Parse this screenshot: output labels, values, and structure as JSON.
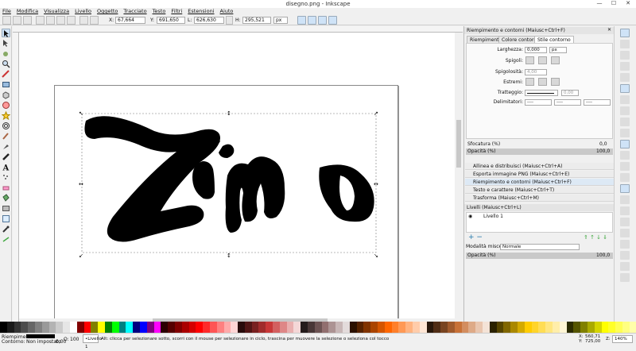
{
  "window": {
    "title": "disegno.png - Inkscape",
    "controls": [
      "—",
      "☐",
      "✕"
    ]
  },
  "menu": [
    "File",
    "Modifica",
    "Visualizza",
    "Livello",
    "Oggetto",
    "Tracciato",
    "Testo",
    "Filtri",
    "Estensioni",
    "Aiuto"
  ],
  "toolctrl": {
    "x_label": "X:",
    "x": "67,664",
    "y_label": "Y:",
    "y": "691,650",
    "w_label": "L:",
    "w": "626,630",
    "h_label": "H:",
    "h": "295,521",
    "unit": "px"
  },
  "dock": {
    "title": "Riempimento e contorni (Maiusc+Ctrl+F)",
    "tabs": [
      "Riempimento",
      "Colore contorno",
      "Stile contorno"
    ],
    "width_label": "Larghezza:",
    "width_value": "0,000",
    "width_unit": "px",
    "join_label": "Spigoli:",
    "miter_label": "Spigolosità:",
    "miter_value": "4,00",
    "cap_label": "Estremi:",
    "dash_label": "Tratteggio:",
    "dash_value": "0,00",
    "markers_label": "Delimitatori:",
    "marker_value": "----",
    "blur_label": "Sfocatura (%)",
    "blur_value": "0,0",
    "opacity_label": "Opacità (%)",
    "opacity_value": "100,0",
    "panels": [
      "Allinea e distribuisci (Maiusc+Ctrl+A)",
      "Esporta immagine PNG (Maiusc+Ctrl+E)",
      "Riempimento e contorni (Maiusc+Ctrl+F)",
      "Testo e carattere (Maiusc+Ctrl+T)",
      "Trasforma (Maiusc+Ctrl+M)"
    ],
    "layers_title": "Livelli (Maiusc+Ctrl+L)",
    "layer_name": "Livello 1",
    "blend_label": "Modalità miscela:",
    "blend_value": "Normale",
    "layer_opacity_label": "Opacità (%)",
    "layer_opacity_value": "100,0"
  },
  "status": {
    "fill_label": "Riempimento:",
    "stroke_label": "Contorno:",
    "stroke_value": "Non impostato",
    "stroke_width": "0,00",
    "opacity_label": "O:",
    "opacity_value": "100",
    "layer": "•Livello 1",
    "message": "Alt: clicca per selezionare sotto, scorri con il mouse per selezionare in ciclo, trascina per muovere la selezione o seleziona col tocco",
    "x_label": "X:",
    "x": "560,71",
    "y_label": "Y:",
    "y": "725,00",
    "z_label": "Z:",
    "zoom": "140%"
  },
  "palette_colors": [
    "#000000",
    "#1a1a1a",
    "#333333",
    "#4d4d4d",
    "#666666",
    "#808080",
    "#999999",
    "#b3b3b3",
    "#cccccc",
    "#e6e6e6",
    "#ffffff",
    "#800000",
    "#ff0000",
    "#808000",
    "#ffff00",
    "#008000",
    "#00ff00",
    "#008080",
    "#00ffff",
    "#000080",
    "#0000ff",
    "#800080",
    "#ff00ff",
    "#2b0000",
    "#550000",
    "#800000",
    "#aa0000",
    "#d40000",
    "#ff0000",
    "#ff2a2a",
    "#ff5555",
    "#ff8080",
    "#ffaaaa",
    "#ffd5d5",
    "#280b0b",
    "#501616",
    "#782121",
    "#a02c2c",
    "#c83737",
    "#d35f5f",
    "#de8787",
    "#e9afaf",
    "#f4d7d7",
    "#241c1c",
    "#483737",
    "#6c5353",
    "#916f6f",
    "#ac9393",
    "#c8b7b7",
    "#e3dbdb",
    "#2b1100",
    "#552200",
    "#803300",
    "#aa4400",
    "#d45500",
    "#ff6600",
    "#ff7f2a",
    "#ff9955",
    "#ffb380",
    "#ffccaa",
    "#ffe6d5",
    "#28170b",
    "#502d16",
    "#784421",
    "#a05a2c",
    "#c87137",
    "#d38d5f",
    "#deaa87",
    "#e9c6af",
    "#f4e3d7",
    "#2b2200",
    "#554400",
    "#806600",
    "#aa8800",
    "#d4aa00",
    "#ffcc00",
    "#ffd42a",
    "#ffdd55",
    "#ffe680",
    "#ffeeaa",
    "#fff6d5",
    "#2b2b00",
    "#555500",
    "#808000",
    "#aaaa00",
    "#d4d400",
    "#ffff00",
    "#ffff2a",
    "#ffff55",
    "#ffff80",
    "#ffffaa"
  ]
}
